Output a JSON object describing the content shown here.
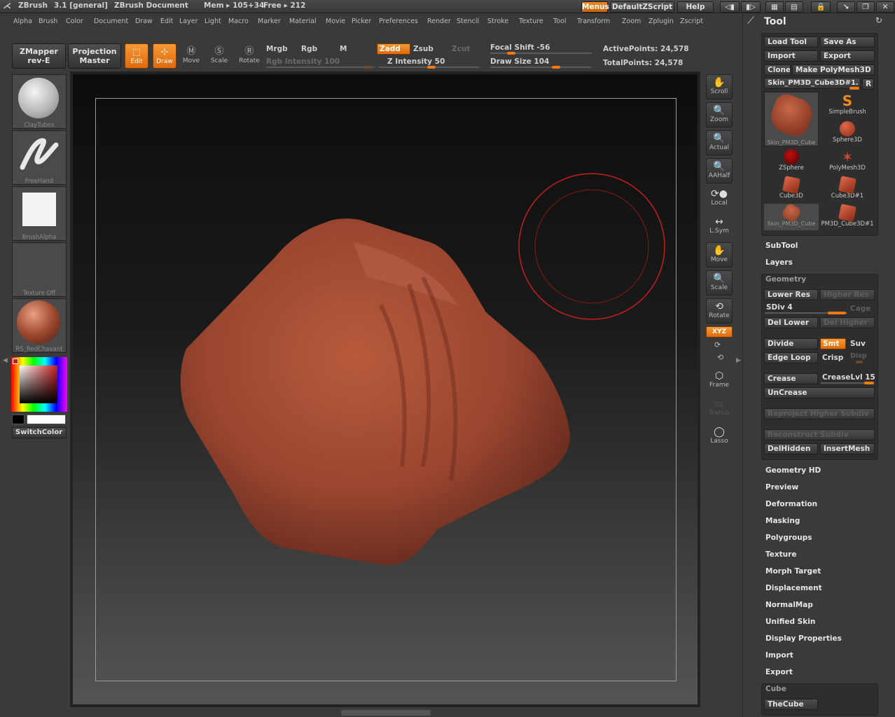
{
  "titlebar": {
    "app": "ZBrush",
    "version": "3.1 [general]",
    "document": "ZBrush Document",
    "mem": "Mem ▸ 105+34",
    "free": "Free ▸ 212",
    "menus_btn": "Menus",
    "script_btn": "DefaultZScript",
    "help_btn": "Help"
  },
  "menu": [
    "Alpha",
    "Brush",
    "Color",
    "Document",
    "Draw",
    "Edit",
    "Layer",
    "Light",
    "Macro",
    "Marker",
    "Material",
    "Movie",
    "Picker",
    "Preferences",
    "Render",
    "Stencil",
    "Stroke",
    "Texture",
    "Tool",
    "Transform",
    "Zoom",
    "Zplugin",
    "Zscript"
  ],
  "toolbar": {
    "zmapper_line1": "ZMapper",
    "zmapper_line2": "rev-E",
    "projection_line1": "Projection",
    "projection_line2": "Master",
    "edit": "Edit",
    "draw": "Draw",
    "move": "Move",
    "scale": "Scale",
    "rotate": "Rotate",
    "mrgb": "Mrgb",
    "rgb": "Rgb",
    "m": "M",
    "rgb_intensity": "Rgb Intensity 100",
    "zadd": "Zadd",
    "zsub": "Zsub",
    "zcut": "Zcut",
    "z_intensity": "Z Intensity 50",
    "focal_shift": "Focal Shift -56",
    "draw_size": "Draw Size 104",
    "active_points": "ActivePoints: 24,578",
    "total_points": "TotalPoints: 24,578"
  },
  "left_shelf": {
    "brush": "ClayTubes",
    "stroke": "FreeHand",
    "alpha": "BrushAlpha",
    "texture": "Texture Off",
    "material": "RS_RedChavant",
    "switch_color": "SwitchColor"
  },
  "right_shelf": [
    "Scroll",
    "Zoom",
    "Actual",
    "AAHalf",
    "Local",
    "L.Sym",
    "Move",
    "Scale",
    "Rotate",
    "XYZ",
    "Frame",
    "Transp",
    "Lasso"
  ],
  "tool_panel": {
    "title": "Tool",
    "load_tool": "Load Tool",
    "save_as": "Save As",
    "import": "Import",
    "export": "Export",
    "clone": "Clone",
    "make_polymesh": "Make PolyMesh3D",
    "current_tool": "Skin_PM3D_Cube3D#1.",
    "r_btn": "R",
    "thumbs": [
      {
        "label": "Skin_PM3D_Cube"
      },
      {
        "label": "SimpleBrush"
      },
      {
        "label": "Sphere3D"
      },
      {
        "label": "ZSphere"
      },
      {
        "label": "PolyMesh3D"
      },
      {
        "label": "Cube3D"
      },
      {
        "label": "Cube3D#1"
      },
      {
        "label": "Skin_PM3D_Cube"
      },
      {
        "label": "PM3D_Cube3D#1"
      }
    ],
    "subtool": "SubTool",
    "layers": "Layers",
    "geometry": {
      "header": "Geometry",
      "lower_res": "Lower Res",
      "higher_res": "Higher Res",
      "sdiv": "SDiv 4",
      "cage": "Cage",
      "del_lower": "Del Lower",
      "del_higher": "Del Higher",
      "divide": "Divide",
      "smt": "Smt",
      "suv": "Suv",
      "edge_loop": "Edge Loop",
      "crisp": "Crisp",
      "disp": "Disp",
      "crease": "Crease",
      "crease_lvl": "CreaseLvl 15",
      "uncrease": "UnCrease",
      "reproject": "Reproject Higher Subdiv",
      "reconstruct": "Reconstruct Subdiv",
      "delhidden": "DelHidden",
      "insertmesh": "InsertMesh"
    },
    "sections": [
      "Geometry HD",
      "Preview",
      "Deformation",
      "Masking",
      "Polygroups",
      "Texture",
      "Morph Target",
      "Displacement",
      "NormalMap",
      "Unified Skin",
      "Display Properties",
      "Import",
      "Export"
    ],
    "cube_header": "Cube",
    "thecube": "TheCube"
  },
  "colors": {
    "accent": "#f07a10",
    "mesh": "#a04a30",
    "cursor": "#c41e1e"
  }
}
